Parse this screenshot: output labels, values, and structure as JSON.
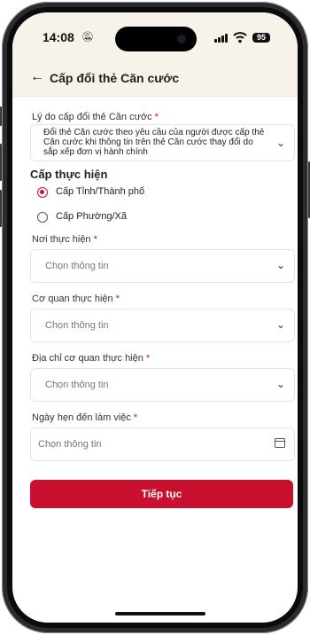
{
  "status_bar": {
    "time": "14:08",
    "battery": "95"
  },
  "header": {
    "back_icon": "arrow-left-icon",
    "title": "Cấp đổi thẻ Căn cước"
  },
  "reason": {
    "label": "Lý do cấp đổi thẻ Căn cước",
    "required": "*",
    "value": "Đổi thẻ Căn cước theo yêu cầu của người được cấp thẻ Căn cước khi thông tin trên thẻ Căn cước thay đổi do sắp xếp đơn vị hành chính"
  },
  "level": {
    "label": "Cấp thực hiện",
    "options": [
      "Cấp Tỉnh/Thành phố",
      "Cấp Phường/Xã"
    ],
    "selected": "Cấp Tỉnh/Thành phố"
  },
  "place": {
    "label": "Nơi thực hiện",
    "required": "*",
    "placeholder": "Chọn thông tin"
  },
  "agency": {
    "label": "Cơ quan thực hiện",
    "required": "*",
    "placeholder": "Chọn thông tin"
  },
  "address": {
    "label": "Địa chỉ cơ quan thực hiện",
    "required": "*",
    "placeholder": "Chọn thông tin"
  },
  "date": {
    "label": "Ngày hẹn đến làm việc",
    "required": "*",
    "placeholder": "Chọn thông tin"
  },
  "submit": {
    "label": "Tiếp tục"
  },
  "colors": {
    "accent": "#c8102e",
    "header_bg": "#f7f2ea"
  }
}
